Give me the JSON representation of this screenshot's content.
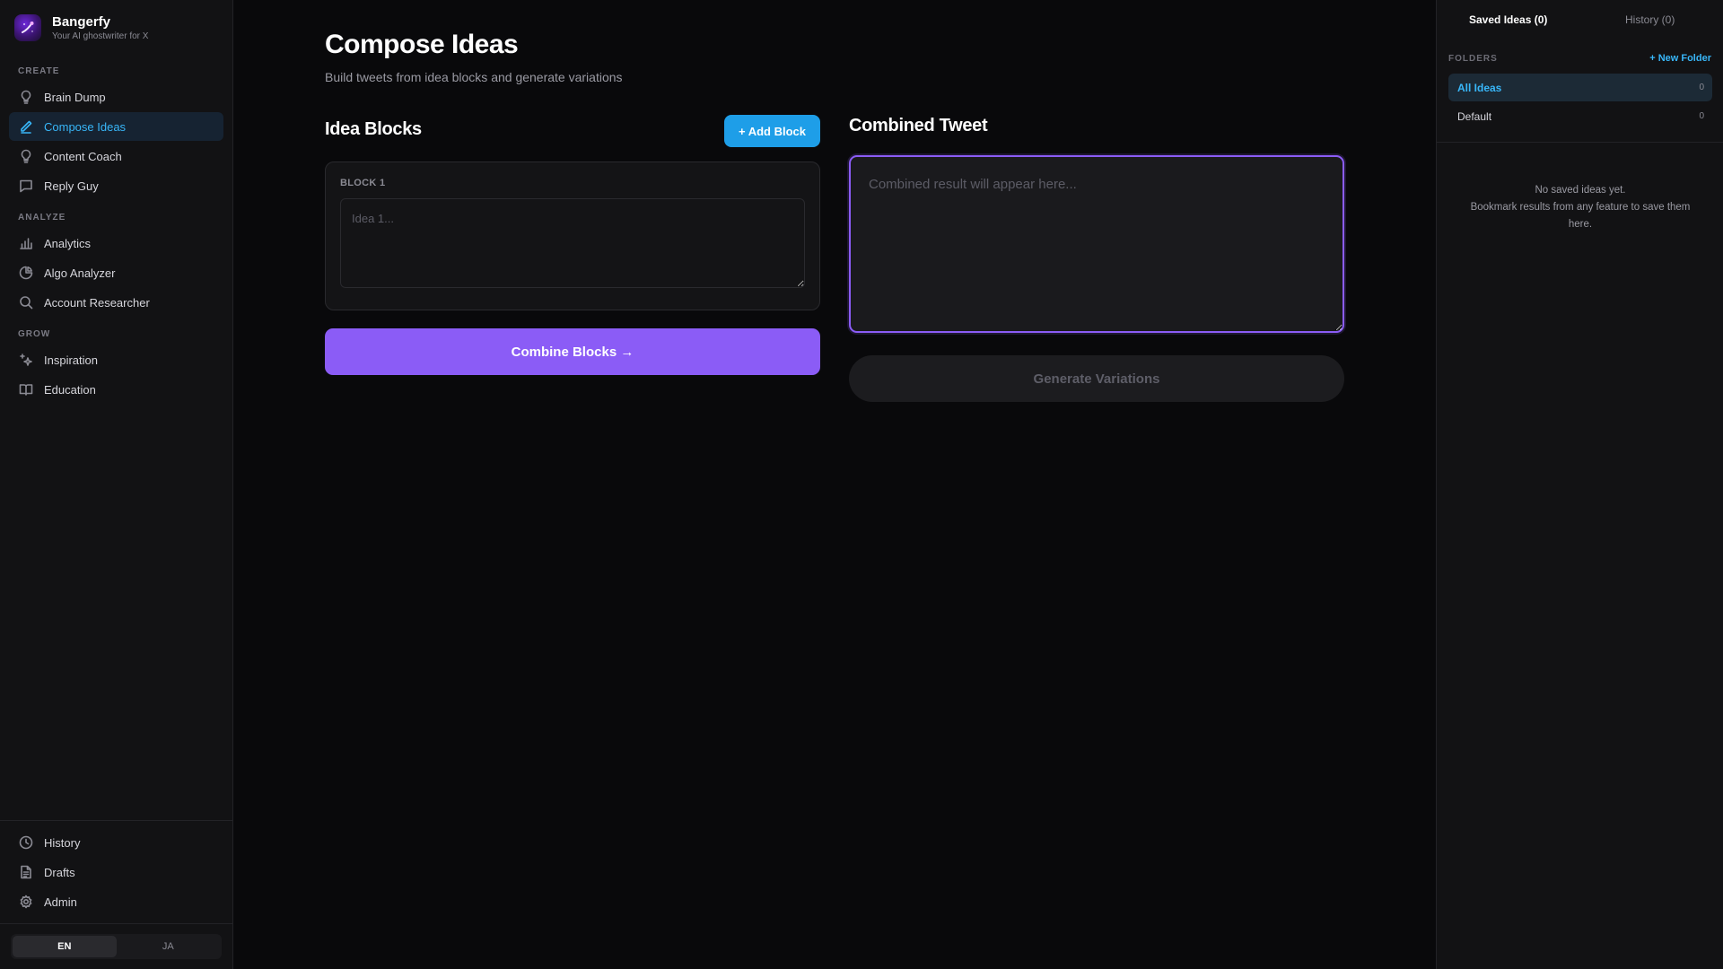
{
  "brand": {
    "name": "Bangerfy",
    "tagline": "Your AI ghostwriter for X"
  },
  "sidebar": {
    "sections": [
      {
        "label": "CREATE",
        "items": [
          {
            "label": "Brain Dump",
            "icon": "lightbulb-icon"
          },
          {
            "label": "Compose Ideas",
            "icon": "pen-icon",
            "active": true
          },
          {
            "label": "Content Coach",
            "icon": "lightbulb-icon"
          },
          {
            "label": "Reply Guy",
            "icon": "message-square-icon"
          }
        ]
      },
      {
        "label": "ANALYZE",
        "items": [
          {
            "label": "Analytics",
            "icon": "bar-chart-icon"
          },
          {
            "label": "Algo Analyzer",
            "icon": "pie-chart-icon"
          },
          {
            "label": "Account Researcher",
            "icon": "search-icon"
          }
        ]
      },
      {
        "label": "GROW",
        "items": [
          {
            "label": "Inspiration",
            "icon": "sparkles-icon"
          },
          {
            "label": "Education",
            "icon": "book-open-icon"
          }
        ]
      }
    ],
    "bottom_items": [
      {
        "label": "History",
        "icon": "clock-icon"
      },
      {
        "label": "Drafts",
        "icon": "file-text-icon"
      },
      {
        "label": "Admin",
        "icon": "gear-icon"
      }
    ],
    "languages": [
      {
        "label": "EN",
        "active": true
      },
      {
        "label": "JA",
        "active": false
      }
    ]
  },
  "main": {
    "title": "Compose Ideas",
    "subtitle": "Build tweets from idea blocks and generate variations",
    "idea_blocks": {
      "heading": "Idea Blocks",
      "add_button": "+ Add Block",
      "blocks": [
        {
          "label": "BLOCK 1",
          "placeholder": "Idea 1...",
          "value": ""
        }
      ],
      "combine_button": "Combine Blocks →"
    },
    "combined": {
      "heading": "Combined Tweet",
      "placeholder": "Combined result will appear here...",
      "value": "",
      "generate_button": "Generate Variations"
    }
  },
  "right_panel": {
    "tabs": [
      {
        "label": "Saved Ideas (0)",
        "active": true
      },
      {
        "label": "History (0)",
        "active": false
      }
    ],
    "folders_label": "FOLDERS",
    "new_folder": "+ New Folder",
    "folders": [
      {
        "name": "All Ideas",
        "count": "0",
        "active": true
      },
      {
        "name": "Default",
        "count": "0",
        "active": false
      }
    ],
    "empty_line1": "No saved ideas yet.",
    "empty_line2": "Bookmark results from any feature to save them here."
  },
  "colors": {
    "background": "#09090b",
    "panel": "#121214",
    "accent_blue": "#38b6f8",
    "accent_purple": "#8b5cf6",
    "button_blue": "#1e9ee8"
  }
}
